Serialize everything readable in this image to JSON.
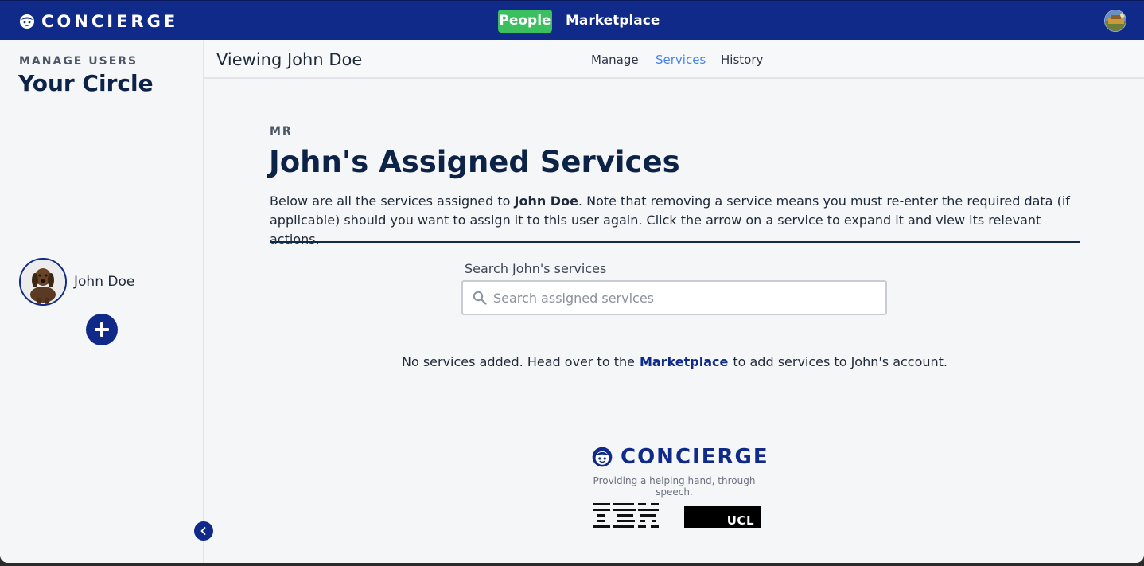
{
  "topbar": {
    "brand": "CONCIERGE",
    "nav": [
      {
        "label": "People",
        "active": true
      },
      {
        "label": "Marketplace",
        "active": false
      }
    ],
    "accent_color": "#102a8a",
    "active_nav_color": "#3bbf5f"
  },
  "sidebar": {
    "subtitle": "MANAGE USERS",
    "title": "Your Circle",
    "users": [
      {
        "name": "John Doe"
      }
    ]
  },
  "subheader": {
    "viewing": "Viewing John Doe",
    "tabs": [
      {
        "label": "Manage",
        "active": false
      },
      {
        "label": "Services",
        "active": true
      },
      {
        "label": "History",
        "active": false
      }
    ]
  },
  "main": {
    "prefix": "MR",
    "title": "John's Assigned Services",
    "desc_before": "Below are all the services assigned to ",
    "desc_name": "John Doe",
    "desc_after": ". Note that removing a service means you must re-enter the required data (if applicable) should you want to assign it to this user again. Click the arrow on a service to expand it and view its relevant actions.",
    "search_label": "Search John's services",
    "search_placeholder": "Search assigned services",
    "search_value": "",
    "empty_before": "No services added. Head over to the",
    "empty_link": "Marketplace",
    "empty_after": "to add services to John's account."
  },
  "footer": {
    "brand": "CONCIERGE",
    "tagline": "Providing a helping hand, through speech.",
    "partner_logos": [
      "IBM",
      "UCL"
    ]
  },
  "icons": {
    "brand": "concierge-face-icon",
    "add": "plus-icon",
    "collapse": "chevron-left-icon",
    "search": "search-icon"
  }
}
